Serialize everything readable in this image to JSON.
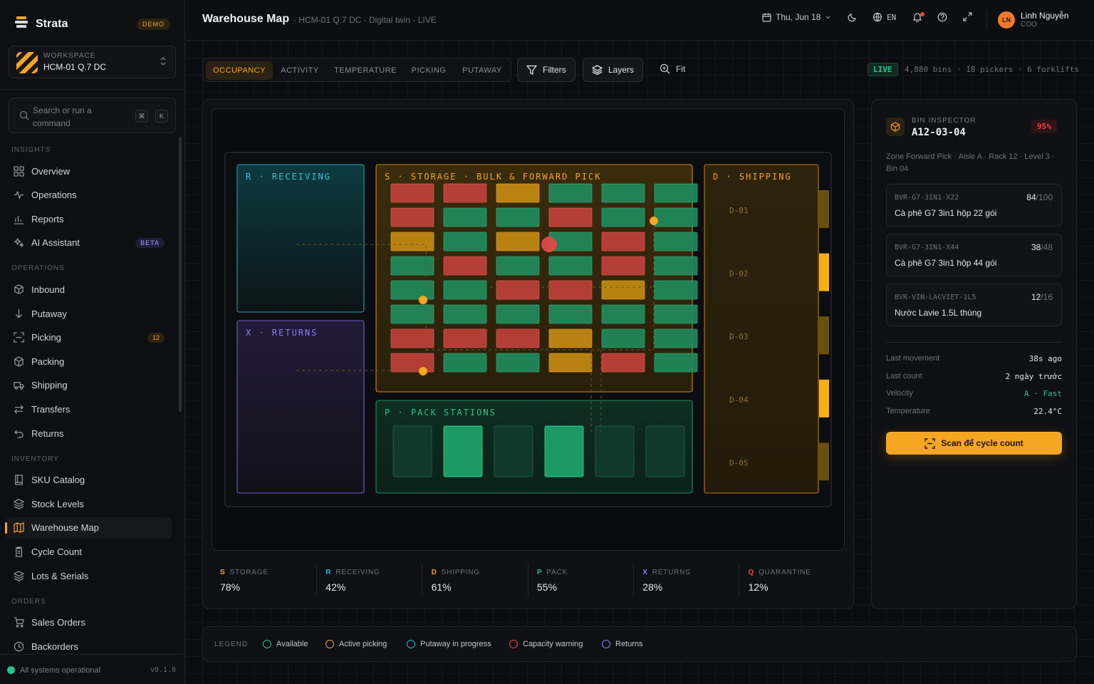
{
  "brand": {
    "name": "Strata",
    "badge": "DEMO"
  },
  "workspace": {
    "label": "WORKSPACE",
    "name": "HCM-01 Q.7 DC"
  },
  "search": {
    "placeholder": "Search or run a command",
    "kbd1": "⌘",
    "kbd2": "K"
  },
  "sidebar": {
    "sections": [
      {
        "title": "INSIGHTS",
        "items": [
          {
            "label": "Overview",
            "icon": "grid-icon"
          },
          {
            "label": "Operations",
            "icon": "pulse-icon"
          },
          {
            "label": "Reports",
            "icon": "bar-chart-icon"
          },
          {
            "label": "AI Assistant",
            "icon": "sparkle-icon",
            "badge": "BETA"
          }
        ]
      },
      {
        "title": "OPERATIONS",
        "items": [
          {
            "label": "Inbound",
            "icon": "package-in-icon"
          },
          {
            "label": "Putaway",
            "icon": "arrow-down-icon"
          },
          {
            "label": "Picking",
            "icon": "scan-icon",
            "badge": "12"
          },
          {
            "label": "Packing",
            "icon": "box-icon"
          },
          {
            "label": "Shipping",
            "icon": "truck-icon"
          },
          {
            "label": "Transfers",
            "icon": "transfer-icon"
          },
          {
            "label": "Returns",
            "icon": "return-icon"
          }
        ]
      },
      {
        "title": "INVENTORY",
        "items": [
          {
            "label": "SKU Catalog",
            "icon": "book-icon"
          },
          {
            "label": "Stock Levels",
            "icon": "layers-icon"
          },
          {
            "label": "Warehouse Map",
            "icon": "map-icon",
            "active": true
          },
          {
            "label": "Cycle Count",
            "icon": "clipboard-icon"
          },
          {
            "label": "Lots & Serials",
            "icon": "stack-icon"
          }
        ]
      },
      {
        "title": "ORDERS",
        "items": [
          {
            "label": "Sales Orders",
            "icon": "cart-icon"
          },
          {
            "label": "Backorders",
            "icon": "clock-icon"
          }
        ]
      }
    ],
    "status": "All systems operational",
    "version": "v0.1.0"
  },
  "header": {
    "title": "Warehouse Map",
    "crumb": "· HCM-01 Q.7 DC · Digital twin · LIVE",
    "date": "Thu, Jun 18",
    "lang": "EN",
    "user": {
      "initials": "LN",
      "name": "Linh Nguyễn",
      "role": "COO"
    }
  },
  "toolbar": {
    "tabs": [
      "OCCUPANCY",
      "ACTIVITY",
      "TEMPERATURE",
      "PICKING",
      "PUTAWAY"
    ],
    "active_tab": "OCCUPANCY",
    "filters": "Filters",
    "layers": "Layers",
    "fit": "Fit",
    "live": "LIVE",
    "stats": "4,880 bins · 18 pickers · 6 forklifts"
  },
  "map": {
    "zones": {
      "receiving": "R · RECEIVING",
      "returns": "X · RETURNS",
      "storage": "S · STORAGE · BULK & FORWARD PICK",
      "pack": "P · PACK STATIONS",
      "shipping": "D · SHIPPING"
    },
    "docks": [
      "D-01",
      "D-02",
      "D-03",
      "D-04",
      "D-05"
    ],
    "dock_active": [
      false,
      true,
      false,
      true,
      false
    ],
    "bin_grid": [
      [
        "r",
        "r",
        "y",
        "g",
        "g",
        "g"
      ],
      [
        "r",
        "g",
        "g",
        "r",
        "g",
        "g"
      ],
      [
        "y",
        "g",
        "y",
        "g",
        "r",
        "g"
      ],
      [
        "g",
        "r",
        "g",
        "g",
        "r",
        "g"
      ],
      [
        "g",
        "g",
        "r",
        "r",
        "y",
        "g"
      ],
      [
        "g",
        "g",
        "g",
        "g",
        "g",
        "g"
      ],
      [
        "r",
        "r",
        "r",
        "y",
        "g",
        "g"
      ],
      [
        "r",
        "g",
        "g",
        "y",
        "r",
        "g"
      ]
    ],
    "pack_stations_active": [
      false,
      true,
      false,
      true,
      false,
      false
    ],
    "colors": {
      "g": "#1f8a5c",
      "r": "#c0413a",
      "y": "#c48a12"
    }
  },
  "zone_stats": [
    {
      "code": "S",
      "name": "STORAGE",
      "value": "78%",
      "color": "#f5a623"
    },
    {
      "code": "R",
      "name": "RECEIVING",
      "value": "42%",
      "color": "#22b8cf"
    },
    {
      "code": "D",
      "name": "SHIPPING",
      "value": "61%",
      "color": "#f5a623"
    },
    {
      "code": "P",
      "name": "PACK",
      "value": "55%",
      "color": "#22c58b"
    },
    {
      "code": "X",
      "name": "RETURNS",
      "value": "28%",
      "color": "#8b7cf6"
    },
    {
      "code": "Q",
      "name": "QUARANTINE",
      "value": "12%",
      "color": "#ef4444"
    }
  ],
  "inspector": {
    "label": "BIN INSPECTOR",
    "bin": "A12-03-04",
    "pct": "95%",
    "desc": "Zone Forward Pick · Aisle A · Rack 12 · Level 3 · Bin 04",
    "skus": [
      {
        "code": "BVR-G7-3IN1-X22",
        "qty": "84",
        "cap": "/100",
        "name": "Cà phê G7 3in1 hộp 22 gói"
      },
      {
        "code": "BVR-G7-3IN1-X44",
        "qty": "38",
        "cap": "/48",
        "name": "Cà phê G7 3in1 hộp 44 gói"
      },
      {
        "code": "BVR-VIN-LACVIET-1L5",
        "qty": "12",
        "cap": "/16",
        "name": "Nước Lavie 1.5L thùng"
      }
    ],
    "details": [
      {
        "k": "Last movement",
        "v": "38s ago"
      },
      {
        "k": "Last count",
        "v": "2 ngày trước"
      },
      {
        "k": "Velocity",
        "v": "A · Fast",
        "accent": "#22c58b"
      },
      {
        "k": "Temperature",
        "v": "22.4°C"
      }
    ],
    "scan_label": "Scan để cycle count"
  },
  "legend": {
    "title": "LEGEND",
    "items": [
      {
        "label": "Available",
        "color": "#22c58b"
      },
      {
        "label": "Active picking",
        "color": "#f5a623"
      },
      {
        "label": "Putaway in progress",
        "color": "#22b8cf"
      },
      {
        "label": "Capacity warning",
        "color": "#ef4444"
      },
      {
        "label": "Returns",
        "color": "#8b7cf6"
      }
    ]
  }
}
